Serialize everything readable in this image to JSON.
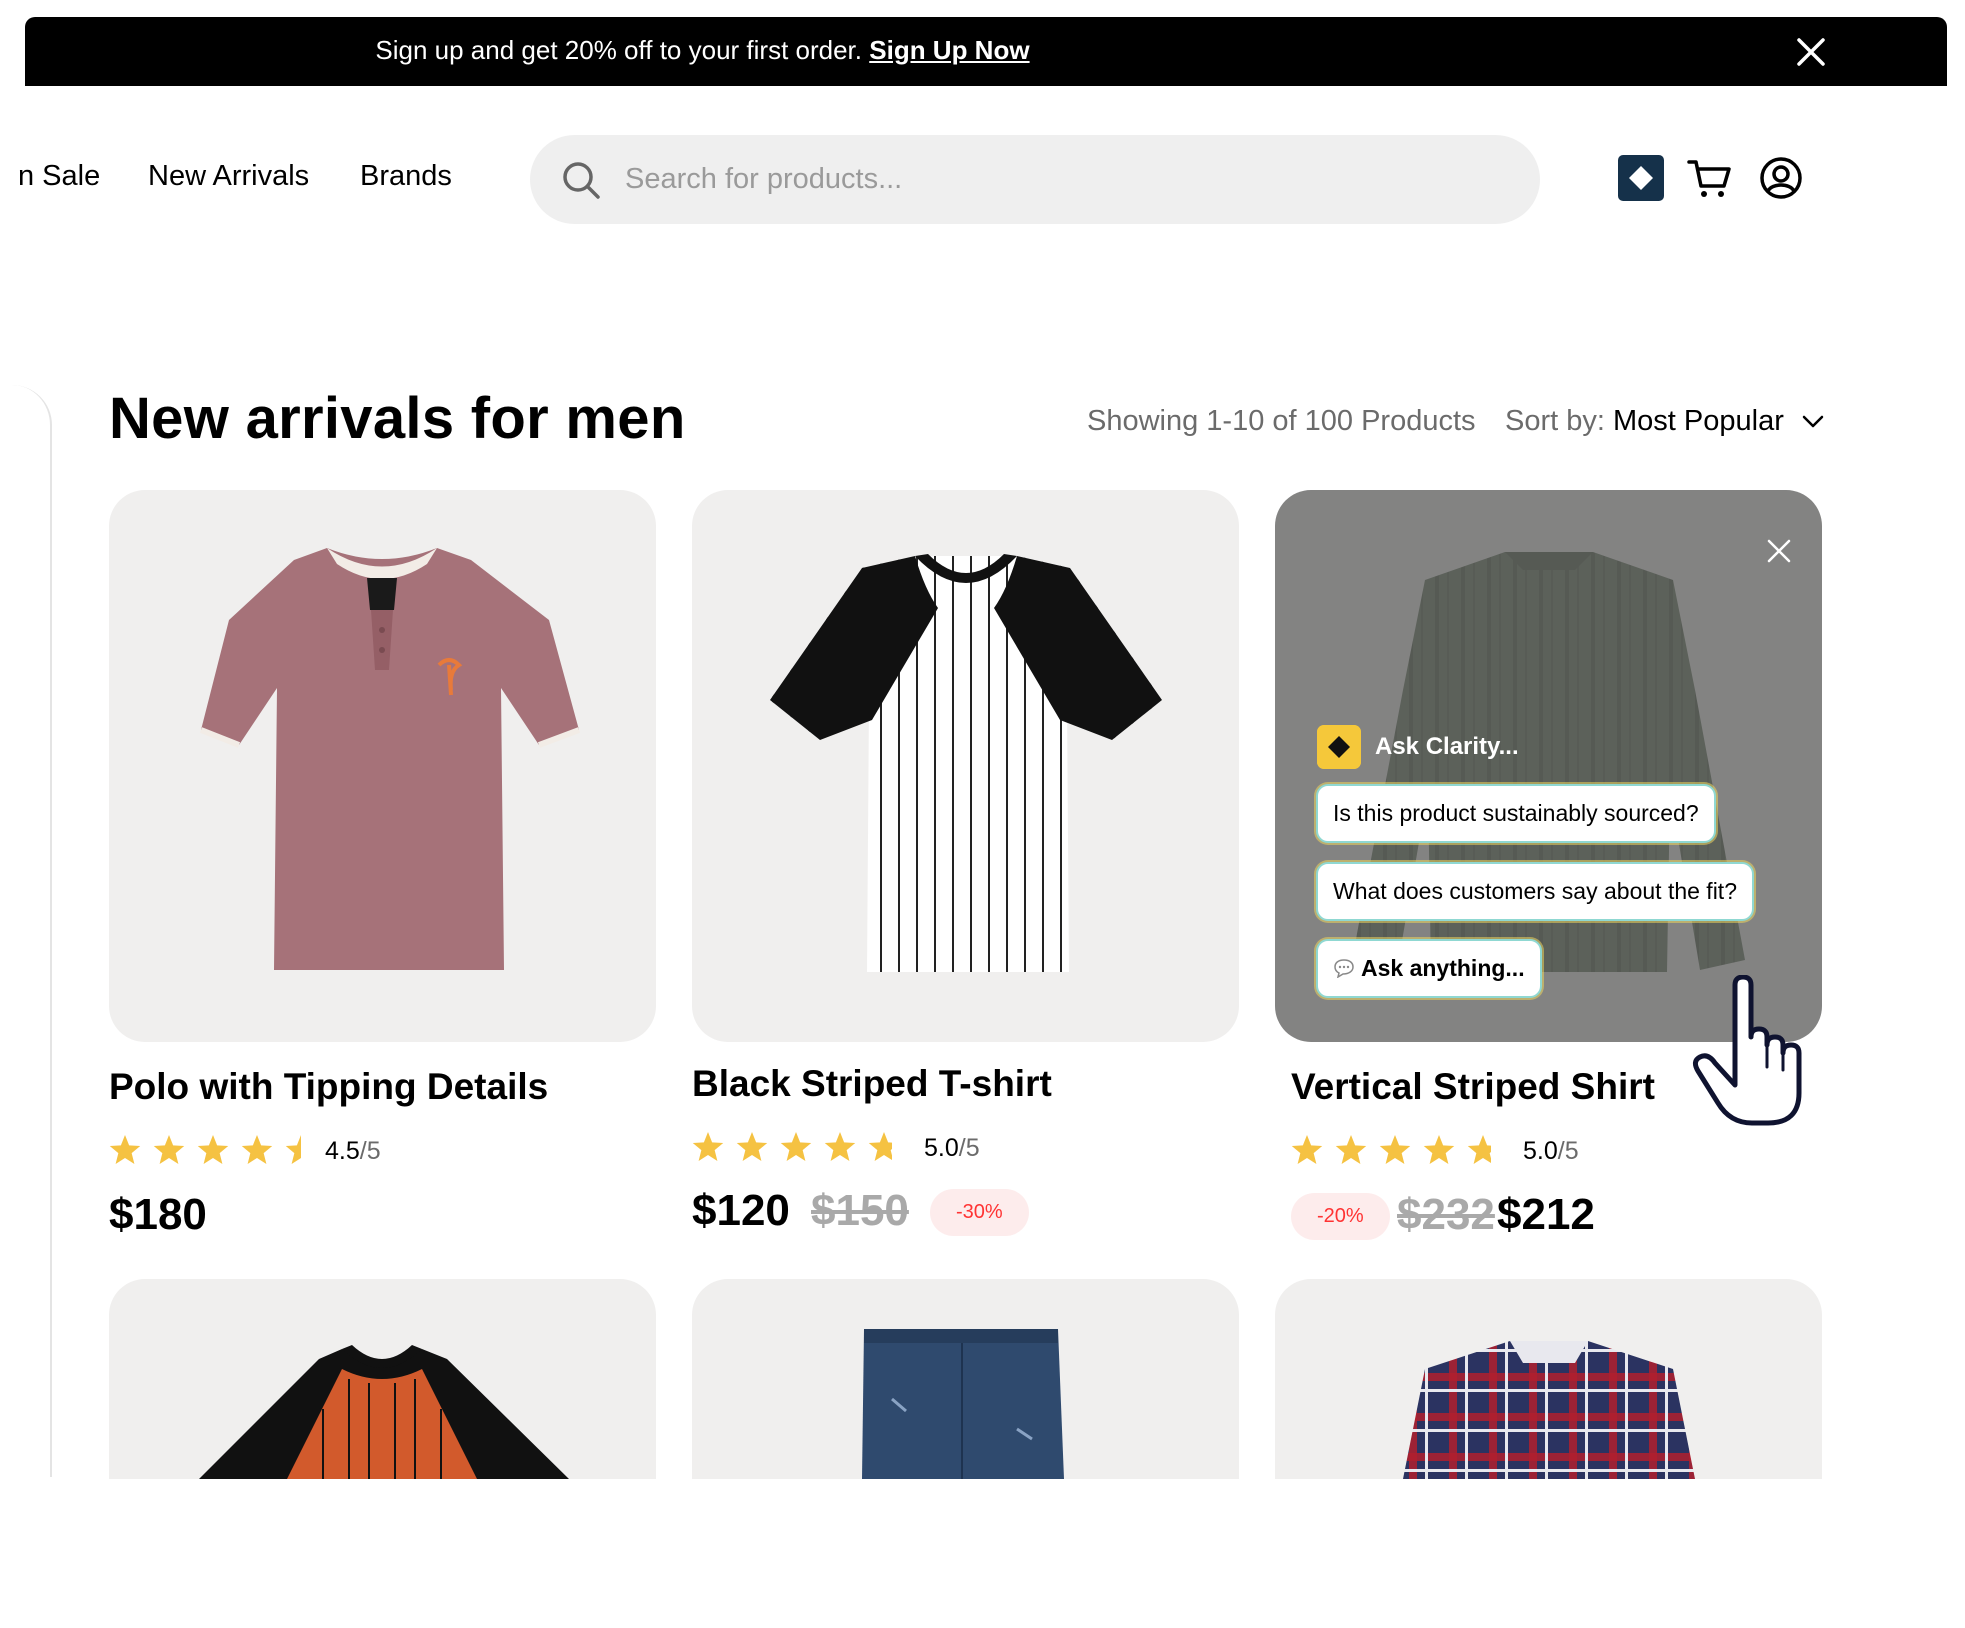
{
  "banner": {
    "text": "Sign up and get 20% off to your first order.",
    "link_label": "Sign Up Now",
    "close_icon": "close-icon"
  },
  "header": {
    "nav": [
      "n Sale",
      "New Arrivals",
      "Brands"
    ],
    "search_placeholder": "Search for products...",
    "icons": [
      "clarity-logo-icon",
      "cart-icon",
      "user-account-icon"
    ]
  },
  "main": {
    "title": "New arrivals for men",
    "showing": "Showing 1-10 of 100 Products",
    "sort_label": "Sort by:",
    "sort_value": "Most Popular"
  },
  "products": [
    {
      "name": "Polo with Tipping Details",
      "rating": "4.5",
      "rating_den": "/5",
      "rating_value": 4.5,
      "price": "$180"
    },
    {
      "name": "Black Striped T-shirt",
      "rating": "5.0",
      "rating_den": "/5",
      "rating_value": 5.0,
      "price": "$120",
      "old_price": "$150",
      "discount": "-30%"
    },
    {
      "name": "Vertical Striped Shirt",
      "rating": "5.0",
      "rating_den": "/5",
      "rating_value": 5.0,
      "price": "$212",
      "old_price": "$232",
      "discount": "-20%"
    }
  ],
  "clarity": {
    "title": "Ask Clarity...",
    "suggestions": [
      "Is this product sustainably sourced?",
      "What does customers say about the fit?"
    ],
    "ask_anything": "Ask anything..."
  },
  "colors": {
    "banner_bg": "#000000",
    "star": "#f5c242",
    "discount_text": "#ff3333",
    "discount_bg": "#fdecec",
    "card_bg": "#f0efee",
    "clarity_yellow": "#f5c83a",
    "clarity_chip_border": "#8fd8d2"
  }
}
